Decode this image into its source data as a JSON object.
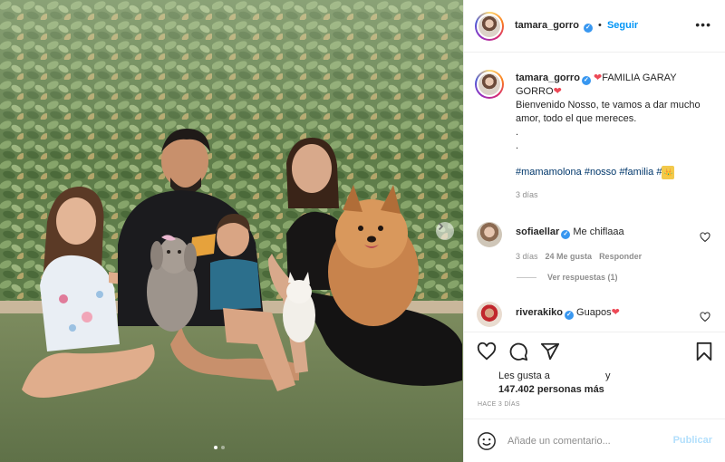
{
  "post": {
    "username": "tamara_gorro",
    "follow_label": "Seguir",
    "more_label": "•••",
    "verified_mark": "✓"
  },
  "caption": {
    "username": "tamara_gorro",
    "heart_glyph": "❤",
    "line1": "FAMILIA GARAY GORRO",
    "line2": "Bienvenido Nosso, te vamos a dar mucho amor, todo el que mereces.",
    "dot": ".",
    "hashtags": [
      "#mamamolona",
      "#nosso",
      "#familia",
      "#"
    ],
    "crown": "👑",
    "time": "3 días"
  },
  "comments": [
    {
      "username": "sofiaellar",
      "text": "Me chiflaaa",
      "time": "3 días",
      "likes": "24 Me gusta",
      "reply_label": "Responder",
      "view_replies": "Ver respuestas (1)"
    },
    {
      "username": "riverakiko",
      "text": "Guapos",
      "heart_glyph": "❤"
    }
  ],
  "likes": {
    "prefix": "Les gusta a",
    "suffix": "y",
    "count_text": "147.402 personas más"
  },
  "time_ago": "HACE 3 DÍAS",
  "add_comment": {
    "placeholder": "Añade un comentario...",
    "post_label": "Publicar"
  },
  "icons": {
    "like": "heart-icon",
    "comment": "comment-icon",
    "share": "share-icon",
    "save": "bookmark-icon",
    "emoji": "emoji-icon",
    "next": "chevron-right-icon"
  },
  "colors": {
    "link": "#0095f6",
    "hashtag": "#00376b",
    "muted": "#8e8e8e",
    "verified": "#3897f0",
    "heart": "#ed4956"
  },
  "carousel": {
    "slides": 2,
    "current": 1
  }
}
